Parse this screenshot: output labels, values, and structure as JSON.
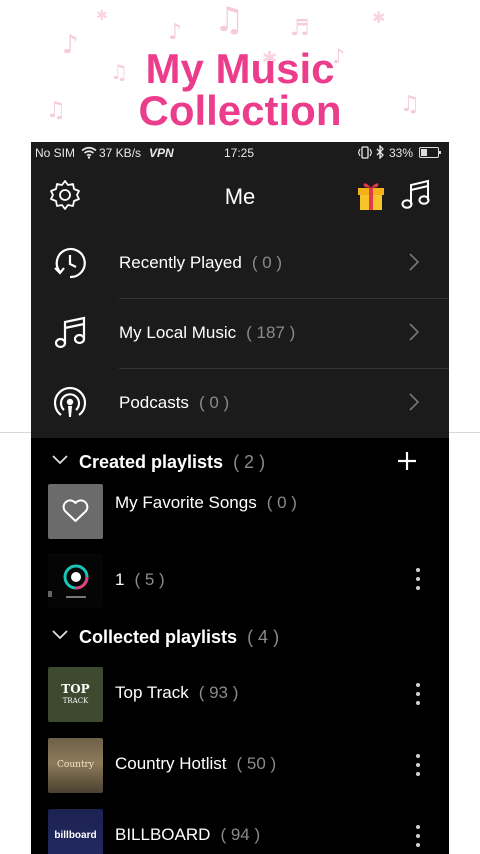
{
  "promo": {
    "title_line1": "My Music",
    "title_line2": "Collection"
  },
  "status_bar": {
    "carrier": "No SIM",
    "speed": "37 KB/s",
    "vpn": "VPN",
    "time": "17:25",
    "battery": "33%"
  },
  "appbar": {
    "title": "Me",
    "icons": [
      "settings-gear-icon",
      "gift-icon",
      "music-note-icon"
    ]
  },
  "menu": [
    {
      "label": "Recently Played",
      "count": "( 0 )",
      "icon": "clock-history-icon"
    },
    {
      "label": "My Local Music",
      "count": "( 187 )",
      "icon": "music-note-icon"
    },
    {
      "label": "Podcasts",
      "count": "( 0 )",
      "icon": "podcast-icon"
    }
  ],
  "created": {
    "title": "Created playlists",
    "count": "( 2 )",
    "items": [
      {
        "label": "My Favorite Songs",
        "count": "( 0 )",
        "cover": "heart-icon"
      },
      {
        "label": "1",
        "count": "( 5 )",
        "cover": "album-art"
      }
    ]
  },
  "collected": {
    "title": "Collected playlists",
    "count": "( 4 )",
    "items": [
      {
        "label": "Top Track",
        "count": "( 93 )",
        "cover_text": "TOP",
        "cover_subtext": "TRACK"
      },
      {
        "label": "Country Hotlist",
        "count": "( 50 )",
        "cover_text": "Country"
      },
      {
        "label": "BILLBOARD",
        "count": "( 94 )",
        "cover_text": "billboard"
      }
    ]
  },
  "colors": {
    "accent": "#ec3d8d",
    "background": "#000000",
    "panel": "#1b1b1b",
    "muted": "#8a8a8a"
  }
}
